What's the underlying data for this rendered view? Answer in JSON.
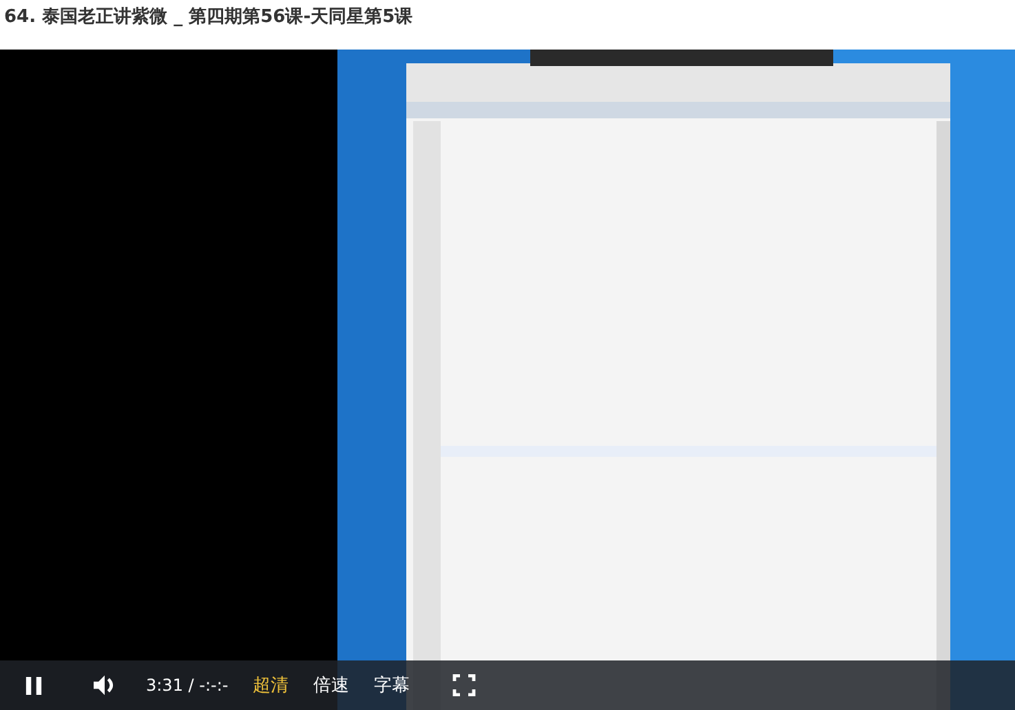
{
  "title": "64. 泰国老正讲紫微 _ 第四期第56课-天同星第5课",
  "player": {
    "playing": true,
    "time": "3:31 / -:-:-",
    "menus": [
      {
        "label": "超清",
        "selected": true
      },
      {
        "label": "倍速",
        "selected": false
      },
      {
        "label": "字幕",
        "selected": false
      }
    ]
  }
}
